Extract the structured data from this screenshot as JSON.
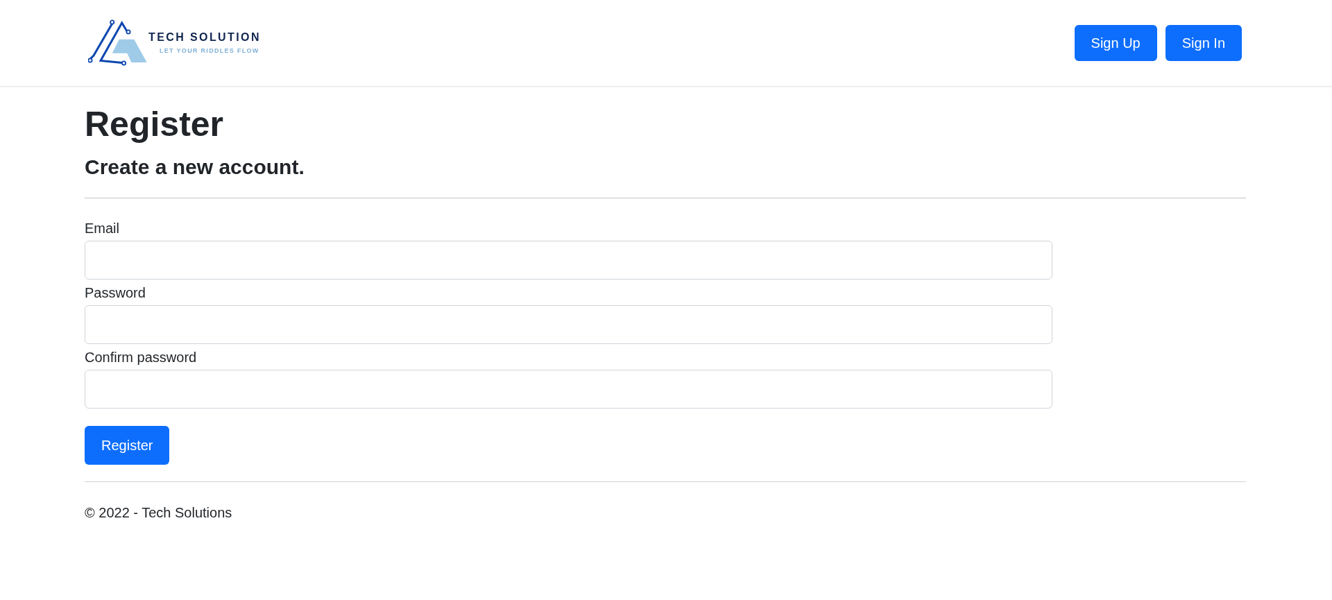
{
  "header": {
    "logo": {
      "title": "TECH SOLUTION",
      "tagline": "LET YOUR RIDDLES FLOW"
    },
    "nav_buttons": [
      "Sign Up",
      "Sign In"
    ]
  },
  "page": {
    "title": "Register",
    "subtitle": "Create a new account."
  },
  "form": {
    "fields": [
      {
        "label": "Email"
      },
      {
        "label": "Password"
      },
      {
        "label": "Confirm password"
      }
    ],
    "submit": "Register"
  },
  "footer": {
    "text": "© 2022 - Tech Solutions"
  }
}
